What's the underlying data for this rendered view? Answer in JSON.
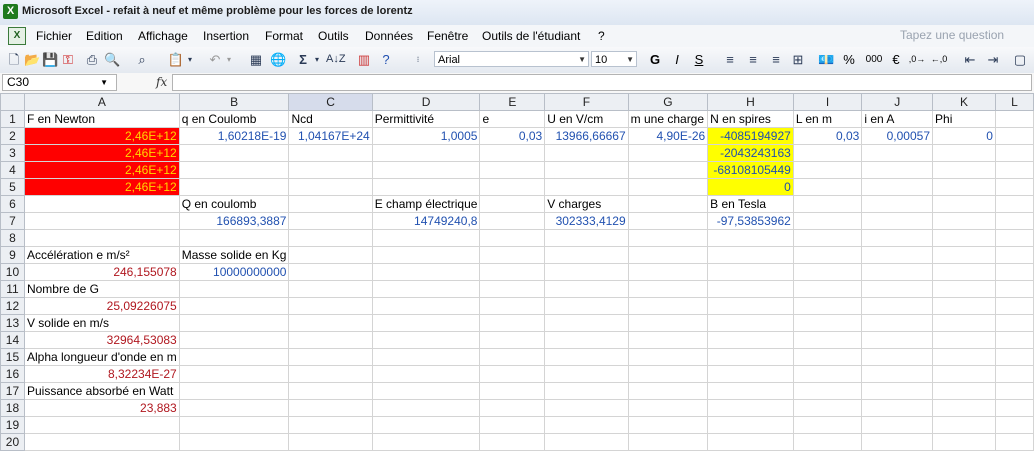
{
  "window": {
    "title": "Microsoft Excel - refait à neuf et même problème pour les forces de lorentz"
  },
  "menu": {
    "items": [
      "Fichier",
      "Edition",
      "Affichage",
      "Insertion",
      "Format",
      "Outils",
      "Données",
      "Fenêtre",
      "Outils de l'étudiant",
      "?"
    ],
    "ask_placeholder": "Tapez une question"
  },
  "toolbar": {
    "font_name": "Arial",
    "font_size": "10"
  },
  "formula_bar": {
    "name_box": "C30",
    "fx": "fx",
    "formula": ""
  },
  "columns": [
    "A",
    "B",
    "C",
    "D",
    "E",
    "F",
    "G",
    "H",
    "I",
    "J",
    "K",
    "L"
  ],
  "rows": [
    "1",
    "2",
    "3",
    "4",
    "5",
    "6",
    "7",
    "8",
    "9",
    "10",
    "11",
    "12",
    "13",
    "14",
    "15",
    "16",
    "17",
    "18",
    "19",
    "20"
  ],
  "cells": {
    "A1": "F en Newton",
    "B1": "q en Coulomb",
    "C1": "Ncd",
    "D1": "Permittivité",
    "E1": "e",
    "F1": "U en V/cm",
    "G1": "m une charge",
    "H1": "N en spires",
    "I1": "L en m",
    "J1": "i en A",
    "K1": "Phi",
    "A2": "2,46E+12",
    "B2": "1,60218E-19",
    "C2": "1,04167E+24",
    "D2": "1,0005",
    "E2": "0,03",
    "F2": "13966,66667",
    "G2": "4,90E-26",
    "H2": "-4085194927",
    "I2": "0,03",
    "J2": "0,00057",
    "K2": "0",
    "A3": "2,46E+12",
    "H3": "-2043243163",
    "A4": "2,46E+12",
    "H4": "-68108105449",
    "A5": "2,46E+12",
    "H5": "0",
    "B6": "Q en coulomb",
    "D6": "E champ électrique",
    "F6": "V charges",
    "H6": "B en Tesla",
    "B7": "166893,3887",
    "D7": "14749240,8",
    "F7": "302333,4129",
    "H7": "-97,53853962",
    "A9": "Accélération e m/s²",
    "B9": "Masse solide en Kg",
    "A10": "246,155078",
    "B10": "10000000000",
    "A11": "Nombre de G",
    "A12": "25,09226075",
    "A13": "V solide en m/s",
    "A14": "32964,53083",
    "A15": "Alpha longueur d'onde en m",
    "A16": "8,32234E-27",
    "A17": "Puissance absorbé en Watt",
    "A18": "23,883"
  }
}
